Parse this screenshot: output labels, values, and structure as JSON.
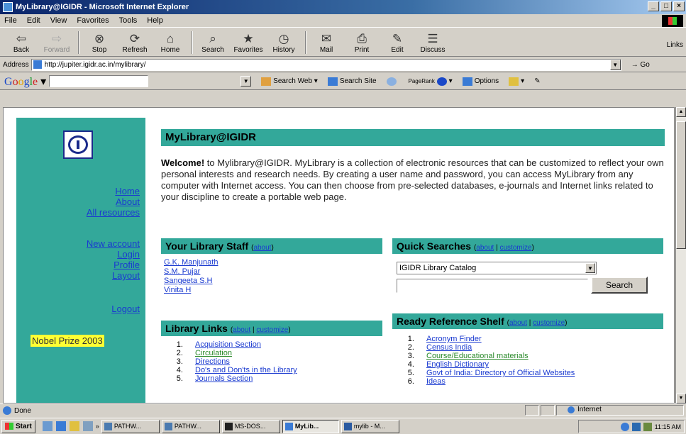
{
  "window": {
    "title": "MyLibrary@IGIDR - Microsoft Internet Explorer",
    "min": "_",
    "max": "□",
    "close": "×"
  },
  "menu": [
    "File",
    "Edit",
    "View",
    "Favorites",
    "Tools",
    "Help"
  ],
  "toolbar": {
    "buttons": [
      {
        "label": "Back",
        "icon": "back-arrow-icon",
        "glyph": "⇦"
      },
      {
        "label": "Forward",
        "icon": "forward-arrow-icon",
        "glyph": "⇨",
        "disabled": true
      },
      {
        "label": "Stop",
        "icon": "stop-icon",
        "glyph": "⊗"
      },
      {
        "label": "Refresh",
        "icon": "refresh-icon",
        "glyph": "⟳"
      },
      {
        "label": "Home",
        "icon": "home-icon",
        "glyph": "⌂"
      },
      {
        "label": "Search",
        "icon": "search-icon",
        "glyph": "⌕"
      },
      {
        "label": "Favorites",
        "icon": "favorites-icon",
        "glyph": "★"
      },
      {
        "label": "History",
        "icon": "history-icon",
        "glyph": "◷"
      },
      {
        "label": "Mail",
        "icon": "mail-icon",
        "glyph": "✉"
      },
      {
        "label": "Print",
        "icon": "print-icon",
        "glyph": "⎙"
      },
      {
        "label": "Edit",
        "icon": "edit-icon",
        "glyph": "✎"
      },
      {
        "label": "Discuss",
        "icon": "discuss-icon",
        "glyph": "☰"
      }
    ],
    "links": "Links"
  },
  "address": {
    "label": "Address",
    "url": "http://jupiter.igidr.ac.in/mylibrary/",
    "go": "Go"
  },
  "google": {
    "search_web": "Search Web",
    "search_site": "Search Site",
    "pagerank": "PageRank",
    "options": "Options"
  },
  "sidebar": {
    "nav1": [
      "Home",
      "About",
      "All resources"
    ],
    "nav2": [
      "New account",
      "Login",
      "Profile",
      "Layout"
    ],
    "logout": "Logout",
    "nobel": "Nobel Prize 2003"
  },
  "main": {
    "title": "MyLibrary@IGIDR",
    "welcome_bold": "Welcome!",
    "welcome_text": " to Mylibrary@IGIDR. MyLibrary is a collection of electronic resources that can be customized to reflect your own personal interests and research needs. By creating a user name and password, you can access MyLibrary from any computer with Internet access. You can then choose from pre-selected databases, e-journals and Internet links related to your discipline to create a portable web page."
  },
  "staff": {
    "title": "Your Library Staff",
    "about": "about",
    "members": [
      "G.K. Manjunath",
      "S.M. Pujar",
      "Sangeeta S.H",
      "Vinita H"
    ]
  },
  "quick": {
    "title": "Quick Searches",
    "about": "about",
    "customize": "customize",
    "select_value": "IGIDR Library Catalog",
    "button": "Search"
  },
  "liblinks": {
    "title": "Library Links",
    "about": "about",
    "customize": "customize",
    "items": [
      "Acquisition Section",
      "Circulation",
      "Directions",
      "Do's and Don'ts in the Library",
      "Journals Section"
    ]
  },
  "ready": {
    "title": "Ready Reference Shelf",
    "about": "about",
    "customize": "customize",
    "items": [
      "Acronym Finder",
      "Census India",
      "Course/Educational materials",
      "English Dictionary",
      "Govt of India: Directory of Official Websites",
      "Ideas"
    ]
  },
  "status": {
    "text": "Done",
    "zone": "Internet"
  },
  "taskbar": {
    "start": "Start",
    "tasks": [
      "PATHW...",
      "PATHW...",
      "MS-DOS...",
      "MyLib...",
      "mylib - M..."
    ],
    "active_index": 3,
    "clock": "11:15 AM"
  },
  "colors": {
    "teal": "#33a89a",
    "link": "#1a3ad0",
    "visited": "#2a8a2a",
    "nobel_bg": "#ffff33"
  }
}
